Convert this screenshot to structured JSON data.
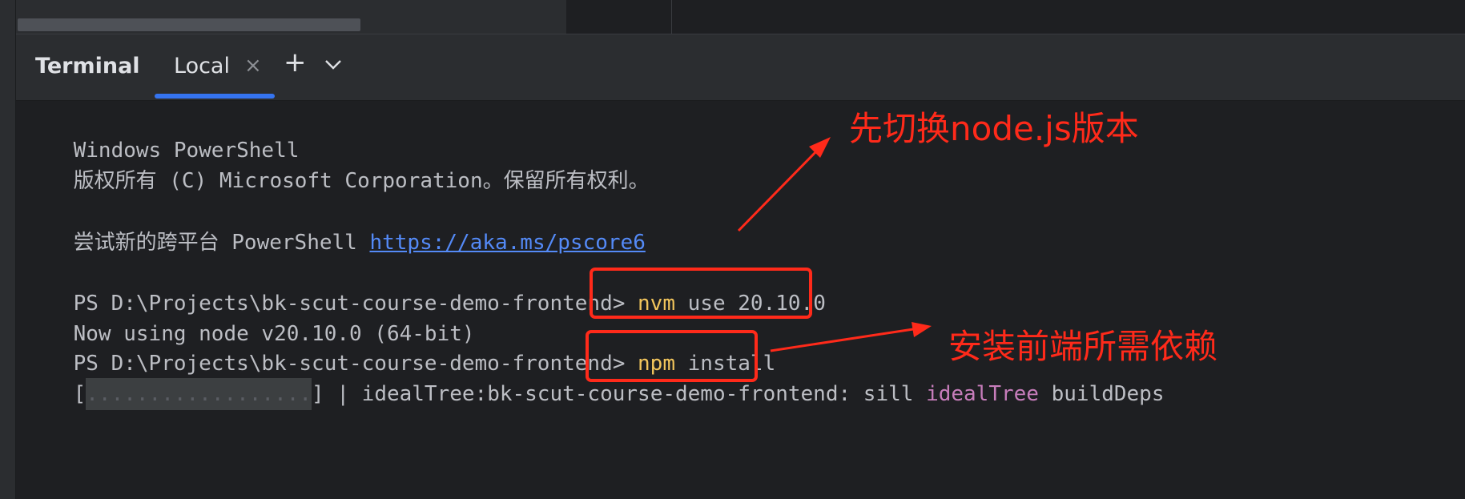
{
  "toolwindow": {
    "title": "Terminal",
    "tabs": [
      {
        "label": "Local",
        "active": true,
        "close_glyph": "×"
      }
    ],
    "new_tab_glyph": "+",
    "dropdown_icon": "chevron-down-icon"
  },
  "terminal": {
    "lines": [
      {
        "text": "Windows PowerShell"
      },
      {
        "text": "版权所有 (C) Microsoft Corporation。保留所有权利。"
      },
      {
        "text": ""
      },
      {
        "prefix": "尝试新的跨平台 PowerShell ",
        "link": "https://aka.ms/pscore6"
      },
      {
        "text": ""
      },
      {
        "prompt": "PS D:\\Projects\\bk-scut-course-demo-frontend>",
        "cmd": "nvm",
        "args": "use 20.10.0"
      },
      {
        "text": "Now using node v20.10.0 (64-bit)"
      },
      {
        "prompt": "PS D:\\Projects\\bk-scut-course-demo-frontend>",
        "cmd": "npm",
        "args": "install"
      },
      {
        "bar_open": "[",
        "bar_fill": "..................",
        "bar_close": "]",
        "status_prefix": " | idealTree:bk-scut-course-demo-frontend: sill ",
        "status_highlight": "idealTree",
        "status_suffix": " buildDeps"
      }
    ]
  },
  "annotations": [
    {
      "text": "先切换node.js版本"
    },
    {
      "text": "安装前端所需依赖"
    }
  ],
  "colors": {
    "terminal_bg": "#1e1f22",
    "toolbar_bg": "#2b2d30",
    "text": "#bcbec4",
    "link": "#548af7",
    "command": "#f2c55c",
    "highlight_purple": "#c77dbb",
    "tab_accent": "#3574f0",
    "annotation_red": "#ff2a1a"
  }
}
